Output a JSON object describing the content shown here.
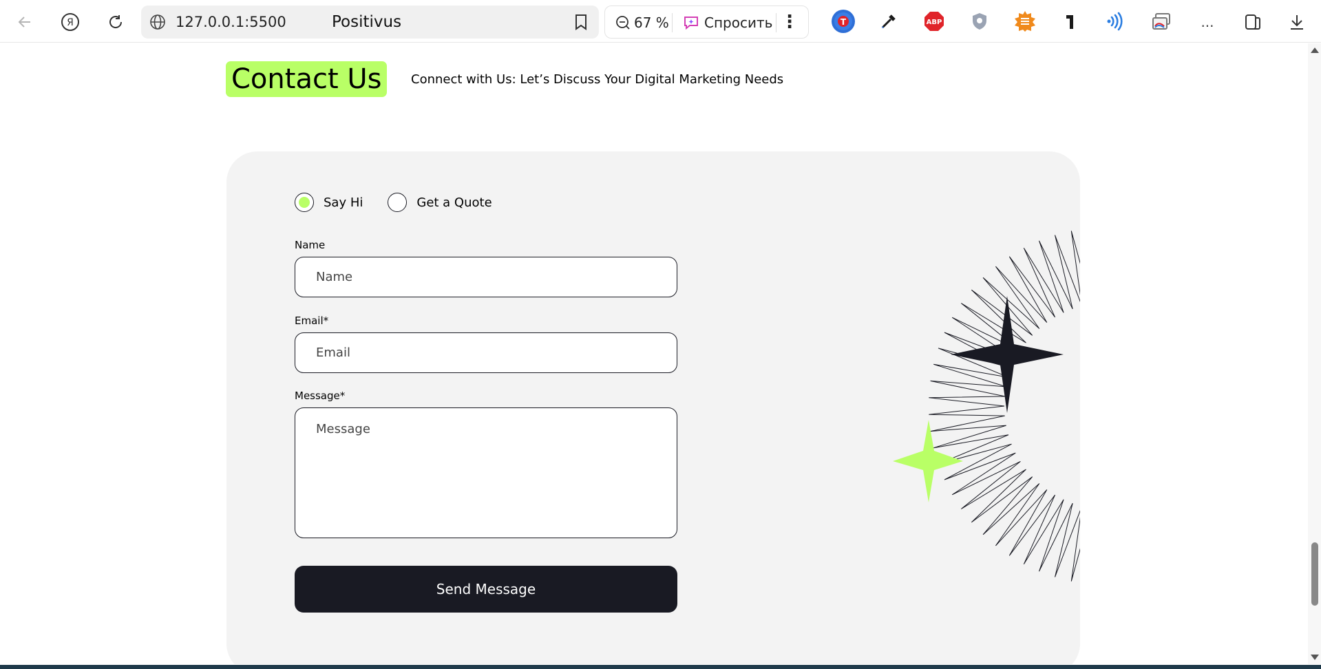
{
  "browser": {
    "url": "127.0.0.1:5500",
    "tab_title": "Positivus",
    "zoom": "67 %",
    "ask_label": "Спросить",
    "more_label": "...",
    "extensions": [
      {
        "name": "translate-extension",
        "color": "#2f6fd6",
        "text": "T"
      },
      {
        "name": "color-picker-extension",
        "color": "#1a1a1a",
        "text": ""
      },
      {
        "name": "adblock-extension",
        "color": "#e0242a",
        "text": "ABP"
      },
      {
        "name": "shield-extension",
        "color": "#8a94a6",
        "text": ""
      },
      {
        "name": "reader-extension",
        "color": "#f08a1c",
        "text": "≡"
      },
      {
        "name": "t-extension",
        "color": "#ffffff",
        "text": "1"
      },
      {
        "name": "wifi-extension",
        "color": "#ffffff",
        "text": ""
      },
      {
        "name": "screenshot-extension",
        "color": "#ffffff",
        "text": ""
      }
    ]
  },
  "page": {
    "heading": "Contact Us",
    "subheading": "Connect with Us: Let’s Discuss Your Digital Marketing Needs"
  },
  "form": {
    "options": [
      {
        "label": "Say Hi",
        "selected": true
      },
      {
        "label": "Get a Quote",
        "selected": false
      }
    ],
    "name_label": "Name",
    "name_placeholder": "Name",
    "email_label": "Email*",
    "email_placeholder": "Email",
    "message_label": "Message*",
    "message_placeholder": "Message",
    "submit_label": "Send Message"
  },
  "colors": {
    "accent": "#b9ff66",
    "dark": "#191a23",
    "card_bg": "#f3f3f3"
  }
}
